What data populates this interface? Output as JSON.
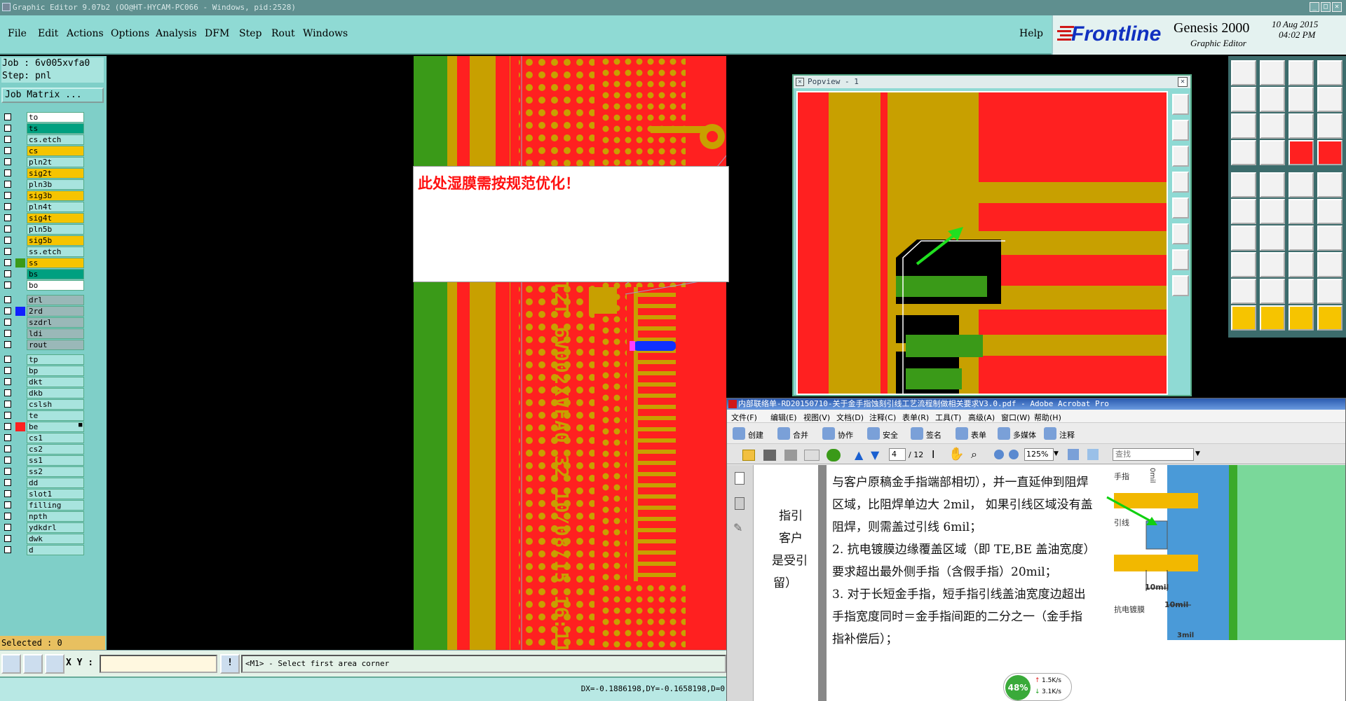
{
  "titlebar": {
    "title": "Graphic Editor 9.07b2 (OO@HT-HYCAM-PC066 - Windows, pid:2528)"
  },
  "menu": {
    "items": [
      "File",
      "Edit",
      "Actions",
      "Options",
      "Analysis",
      "DFM",
      "Step",
      "Rout",
      "Windows"
    ],
    "help": "Help"
  },
  "logo": {
    "brand": "Frontline",
    "product": "Genesis 2000",
    "subtitle": "Graphic Editor",
    "date": "10 Aug 2015",
    "time": "04:02 PM"
  },
  "left": {
    "job_line": "Job : 6v005xvfa0",
    "step_line": "Step: pnl",
    "job_matrix": "Job Matrix ...",
    "layers": [
      {
        "name": "to",
        "bg": "#ffffff"
      },
      {
        "name": "ts",
        "bg": "#00a080"
      },
      {
        "name": "cs.etch",
        "bg": "#a8e4de"
      },
      {
        "name": "cs",
        "bg": "#f6c400"
      },
      {
        "name": "pln2t",
        "bg": "#a8e4de"
      },
      {
        "name": "sig2t",
        "bg": "#f6c400"
      },
      {
        "name": "pln3b",
        "bg": "#a8e4de"
      },
      {
        "name": "sig3b",
        "bg": "#f6c400"
      },
      {
        "name": "pln4t",
        "bg": "#a8e4de"
      },
      {
        "name": "sig4t",
        "bg": "#f6c400"
      },
      {
        "name": "pln5b",
        "bg": "#a8e4de"
      },
      {
        "name": "sig5b",
        "bg": "#f6c400"
      },
      {
        "name": "ss.etch",
        "bg": "#a8e4de"
      },
      {
        "name": "ss",
        "bg": "#f6c400",
        "swatch": "#3a9a18"
      },
      {
        "name": "bs",
        "bg": "#00a080"
      },
      {
        "name": "bo",
        "bg": "#ffffff"
      },
      {
        "name": "drl",
        "bg": "#9ab8b8"
      },
      {
        "name": "2rd",
        "bg": "#9ab8b8",
        "swatch": "#1020ff"
      },
      {
        "name": "szdrl",
        "bg": "#9ab8b8"
      },
      {
        "name": "ldi",
        "bg": "#9ab8b8"
      },
      {
        "name": "rout",
        "bg": "#9ab8b8"
      },
      {
        "name": "tp",
        "bg": "#a8e4de"
      },
      {
        "name": "bp",
        "bg": "#a8e4de"
      },
      {
        "name": "dkt",
        "bg": "#a8e4de"
      },
      {
        "name": "dkb",
        "bg": "#a8e4de"
      },
      {
        "name": "cslsh",
        "bg": "#a8e4de"
      },
      {
        "name": "te",
        "bg": "#a8e4de"
      },
      {
        "name": "be",
        "bg": "#a8e4de",
        "swatch": "#ff2020",
        "marker": "■"
      },
      {
        "name": "cs1",
        "bg": "#a8e4de"
      },
      {
        "name": "cs2",
        "bg": "#a8e4de"
      },
      {
        "name": "ss1",
        "bg": "#a8e4de"
      },
      {
        "name": "ss2",
        "bg": "#a8e4de"
      },
      {
        "name": "dd",
        "bg": "#a8e4de"
      },
      {
        "name": "slot1",
        "bg": "#a8e4de"
      },
      {
        "name": "filling",
        "bg": "#a8e4de"
      },
      {
        "name": "npth",
        "bg": "#a8e4de"
      },
      {
        "name": "ydkdrl",
        "bg": "#a8e4de"
      },
      {
        "name": "dwk",
        "bg": "#a8e4de"
      },
      {
        "name": "d",
        "bg": "#a8e4de"
      }
    ],
    "selected": "Selected : 0"
  },
  "bottom": {
    "xy_label": "X Y :",
    "xy_value": "",
    "prompt": "<M1> - Select first area corner",
    "status": "DX=-0.1886198,DY=-0.1658198,D=0"
  },
  "canvas": {
    "annotation": "此处湿膜需按规范优化！",
    "vertical_text": "21T2T 6V002XVFA0 32 10/08/15 16:11"
  },
  "popview": {
    "title": "Popview - 1"
  },
  "acrobat": {
    "title": "内部联络单-RD20150710-关于金手指蚀刻引线工艺流程制做相关要求V3.0.pdf - Adobe Acrobat Pro",
    "menus": [
      "文件(F)",
      "编辑(E)",
      "视图(V)",
      "文档(D)",
      "注释(C)",
      "表单(R)",
      "工具(T)",
      "高级(A)",
      "窗口(W)",
      "帮助(H)"
    ],
    "toolbar": [
      "创建",
      "合并",
      "协作",
      "安全",
      "签名",
      "表单",
      "多媒体",
      "注释"
    ],
    "page_current": "4",
    "page_total": "/ 12",
    "zoom": "125%",
    "search_placeholder": "查找",
    "left_fragments": [
      "指引",
      "客户",
      "是受引",
      "留）"
    ],
    "doc_lines": [
      "与客户原稿金手指端部相切），并一直延伸到阻焊",
      "区域，比阻焊单边大 2mil， 如果引线区域没有盖",
      "阻焊，则需盖过引线 6mil；",
      "2. 抗电镀膜边缘覆盖区域（即 TE,BE 盖油宽度）",
      "要求超出最外侧手指（含假手指）20mil；",
      "3. 对于长短金手指，短手指引线盖油宽度边超出",
      "手指宽度同时＝金手指间距的二分之一（金手指",
      "指补偿后）；"
    ],
    "diagram_labels": {
      "finger": "手指",
      "lead": "引线",
      "dim1": "10mil",
      "dim2": "10mil",
      "film": "抗电镀膜",
      "top": "0mil",
      "dim3": "3mil"
    },
    "net": {
      "percent": "48%",
      "up": "1.5K/s",
      "down": "3.1K/s"
    }
  }
}
